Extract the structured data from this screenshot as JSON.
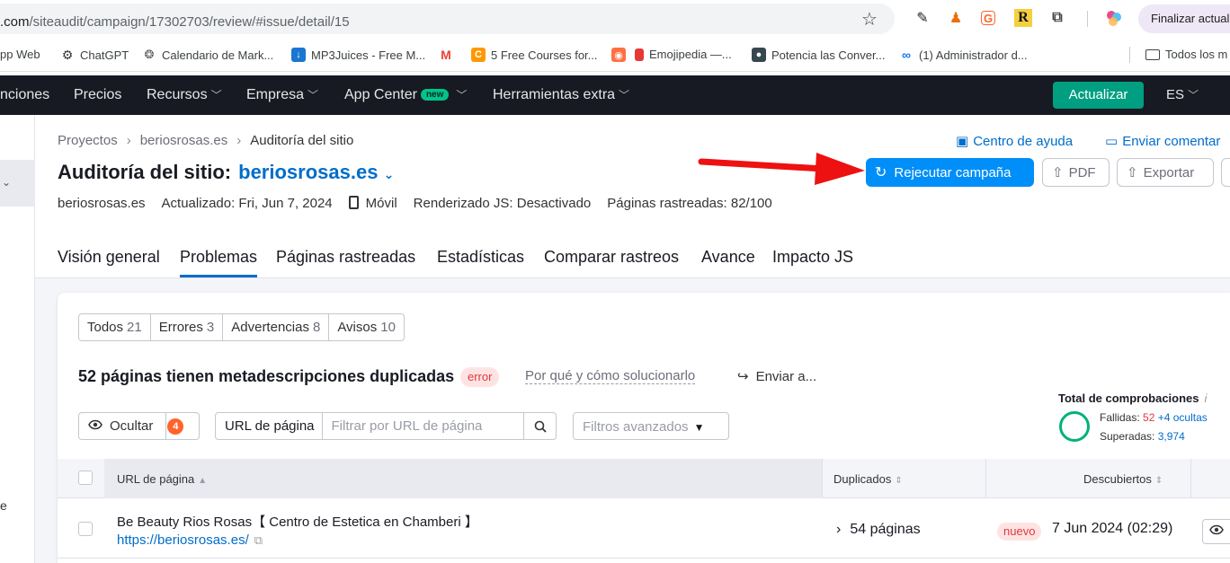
{
  "browser": {
    "url_prefix": ".com",
    "url_path": "/siteaudit/campaign/17302703/review/#issue/detail/15",
    "finalize_label": "Finalizar actuali"
  },
  "bookmarks": [
    {
      "label": "pp Web",
      "icon": "whatsapp-icon"
    },
    {
      "label": "ChatGPT",
      "icon": "openai-icon"
    },
    {
      "label": "Calendario de Mark...",
      "icon": "brain-icon"
    },
    {
      "label": "MP3Juices - Free M...",
      "icon": "download-icon"
    },
    {
      "label": "",
      "icon": "gmail-icon"
    },
    {
      "label": "5 Free Courses for...",
      "icon": "course-icon"
    },
    {
      "label": "",
      "icon": "shield-icon"
    },
    {
      "label": "Emojipedia —...",
      "icon": "emoji-icon"
    },
    {
      "label": "Potencia las Conver...",
      "icon": "avatar-icon"
    },
    {
      "label": "(1) Administrador d...",
      "icon": "meta-icon"
    },
    {
      "label": "Todos los m",
      "icon": "folder-icon"
    }
  ],
  "topnav": {
    "items": [
      "nciones",
      "Precios",
      "Recursos",
      "Empresa",
      "App Center",
      "Herramientas extra"
    ],
    "new_badge": "new",
    "upgrade": "Actualizar",
    "lang": "ES"
  },
  "breadcrumb": [
    "Proyectos",
    "beriosrosas.es",
    "Auditoría del sitio"
  ],
  "help_label": "Centro de ayuda",
  "feedback_label": "Enviar comentar",
  "title": {
    "prefix": "Auditoría del sitio:",
    "domain": "beriosrosas.es"
  },
  "actions": {
    "rerun": "Rejecutar campaña",
    "pdf": "PDF",
    "export": "Exportar"
  },
  "meta": {
    "domain": "beriosrosas.es",
    "updated": "Actualizado: Fri, Jun 7, 2024",
    "device": "Móvil",
    "js": "Renderizado JS: Desactivado",
    "crawled": "Páginas rastreadas: 82/100"
  },
  "tabs": [
    "Visión general",
    "Problemas",
    "Páginas rastreadas",
    "Estadísticas",
    "Comparar rastreos",
    "Avance",
    "Impacto JS"
  ],
  "filters": [
    {
      "label": "Todos",
      "count": "21"
    },
    {
      "label": "Errores",
      "count": "3"
    },
    {
      "label": "Advertencias",
      "count": "8"
    },
    {
      "label": "Avisos",
      "count": "10"
    }
  ],
  "issue": {
    "title": "52 páginas tienen metadescripciones duplicadas",
    "badge": "error",
    "why": "Por qué y cómo solucionarlo",
    "send": "Enviar a..."
  },
  "checks": {
    "title": "Total de comprobaciones",
    "failed_label": "Fallidas:",
    "failed_value": "52",
    "hidden": "+4 ocultas",
    "passed_label": "Superadas:",
    "passed_value": "3,974"
  },
  "toolbar": {
    "hide": "Ocultar",
    "hide_count": "4",
    "url_label": "URL de página",
    "url_placeholder": "Filtrar por URL de página",
    "advanced": "Filtros avanzados"
  },
  "table": {
    "headers": [
      "URL de página",
      "Duplicados",
      "Descubiertos"
    ],
    "rows": [
      {
        "title": "Be Beauty Rios Rosas【 Centro de Estetica en Chamberi 】",
        "url": "https://beriosrosas.es/",
        "duplicates": "54 páginas",
        "badge": "nuevo",
        "discovered": "7 Jun 2024 (02:29)"
      }
    ]
  },
  "colors": {
    "accent": "#008ff8",
    "link": "#006dca",
    "nav_bg": "#171a22",
    "upgrade": "#009f81",
    "error": "#e0383e"
  },
  "rail": {
    "label": "e"
  }
}
